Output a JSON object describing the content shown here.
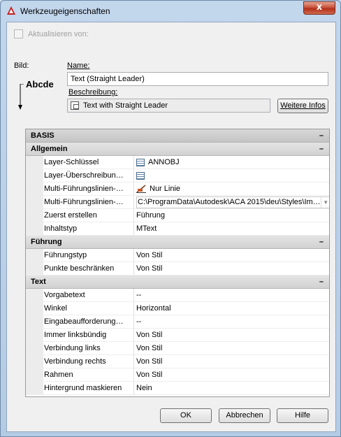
{
  "window": {
    "title": "Werkzeugeigenschaften",
    "close_label": "x"
  },
  "update_from": {
    "label": "Aktualisieren von:"
  },
  "image": {
    "label": "Bild:",
    "preview_text": "Abcde"
  },
  "name": {
    "label": "Name:",
    "value": "Text (Straight Leader)"
  },
  "description": {
    "label": "Beschreibung:",
    "value": "Text with Straight Leader"
  },
  "more_info_button": "Weitere Infos",
  "grid": {
    "basis": {
      "label": "BASIS",
      "toggle": "–"
    },
    "allgemein": {
      "label": "Allgemein",
      "toggle": "–",
      "rows": [
        {
          "name": "Layer-Schlüssel",
          "value": "ANNOBJ",
          "icon": "table-icon"
        },
        {
          "name": "Layer-Überschreibun…",
          "value": "",
          "icon": "table-icon"
        },
        {
          "name": "Multi-Führungslinien-…",
          "value": "Nur Linie",
          "icon": "leader-icon"
        },
        {
          "name": "Multi-Führungslinien-…",
          "value": "C:\\ProgramData\\Autodesk\\ACA 2015\\deu\\Styles\\Im…",
          "icon": "dropdown"
        },
        {
          "name": "Zuerst erstellen",
          "value": "Führung"
        },
        {
          "name": "Inhaltstyp",
          "value": "MText"
        }
      ]
    },
    "fuehrung": {
      "label": "Führung",
      "toggle": "–",
      "rows": [
        {
          "name": "Führungstyp",
          "value": "Von Stil"
        },
        {
          "name": "Punkte beschränken",
          "value": "Von Stil"
        }
      ]
    },
    "text": {
      "label": "Text",
      "toggle": "–",
      "rows": [
        {
          "name": "Vorgabetext",
          "value": "--"
        },
        {
          "name": "Winkel",
          "value": "Horizontal"
        },
        {
          "name": "Eingabeaufforderung…",
          "value": "--"
        },
        {
          "name": "Immer linksbündig",
          "value": "Von Stil"
        },
        {
          "name": "Verbindung links",
          "value": "Von Stil"
        },
        {
          "name": "Verbindung rechts",
          "value": "Von Stil"
        },
        {
          "name": "Rahmen",
          "value": "Von Stil"
        },
        {
          "name": "Hintergrund maskieren",
          "value": "Nein"
        }
      ]
    }
  },
  "buttons": {
    "ok": "OK",
    "cancel": "Abbrechen",
    "help": "Hilfe"
  }
}
